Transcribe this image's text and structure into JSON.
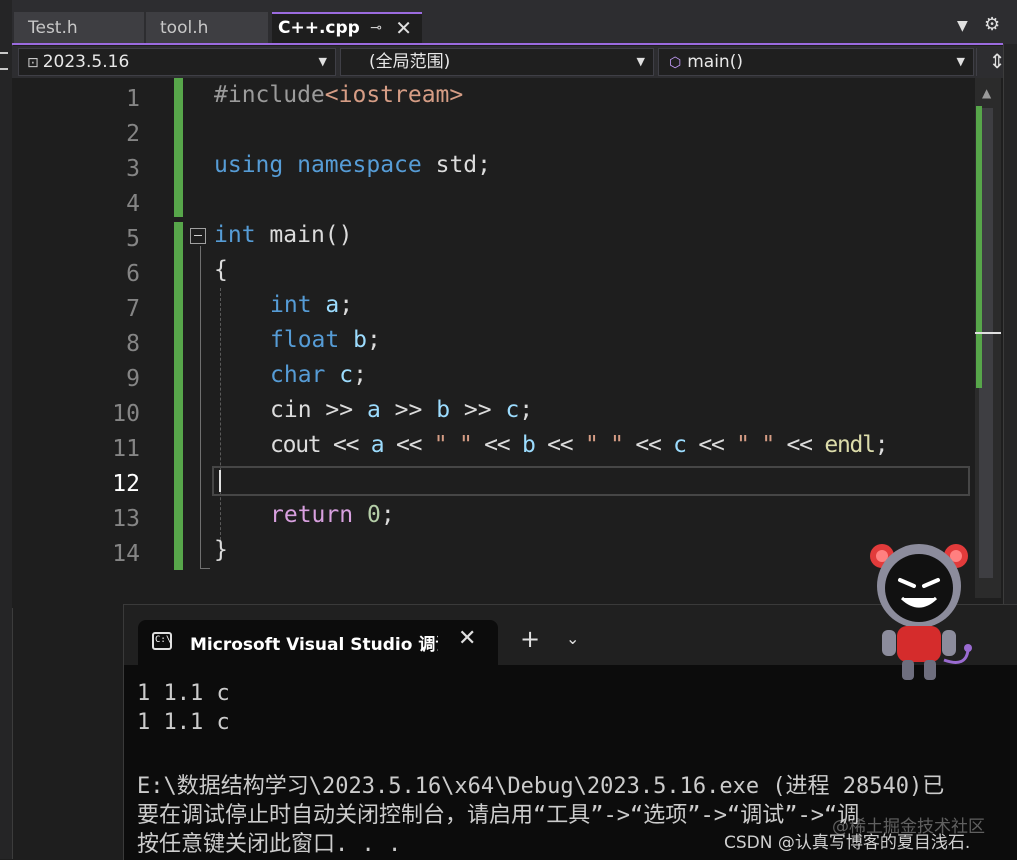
{
  "tabs": [
    {
      "label": "Test.h",
      "active": false
    },
    {
      "label": "tool.h",
      "active": false
    },
    {
      "label": "C++.cpp",
      "active": true
    }
  ],
  "tab_icons": {
    "pin": "pin-icon",
    "close": "close-icon",
    "overflow": "chevron-down-icon",
    "settings": "gear-icon"
  },
  "navbar": {
    "project": "2023.5.16",
    "scope": "(全局范围)",
    "member": "main()"
  },
  "line_numbers": [
    "1",
    "2",
    "3",
    "4",
    "5",
    "6",
    "7",
    "8",
    "9",
    "10",
    "11",
    "12",
    "13",
    "14"
  ],
  "current_line": "12",
  "code": {
    "l1_directive": "#include",
    "l1_header": "<iostream>",
    "l3_using": "using",
    "l3_namespace": "namespace",
    "l3_std": "std;",
    "l5_int": "int",
    "l5_main": "main",
    "l5_parens": "()",
    "l6_brace": "{",
    "l7_type": "int",
    "l7_var": "a",
    "l7_semi": ";",
    "l8_type": "float",
    "l8_var": "b",
    "l8_semi": ";",
    "l9_type": "char",
    "l9_var": "c",
    "l9_semi": ";",
    "l10_cin": "cin",
    "l10_op1": " >> ",
    "l10_a": "a",
    "l10_op2": " >> ",
    "l10_b": "b",
    "l10_op3": " >> ",
    "l10_c": "c",
    "l10_semi": ";",
    "l11_cout": "cout",
    "l11_op1": " << ",
    "l11_a": "a",
    "l11_op2": " << ",
    "l11_s1": "\" \"",
    "l11_op3": " << ",
    "l11_b": "b",
    "l11_op4": " << ",
    "l11_s2": "\" \"",
    "l11_op5": " << ",
    "l11_c": "c",
    "l11_op6": " << ",
    "l11_s3": "\" \"",
    "l11_op7": " << ",
    "l11_endl": "endl",
    "l11_semi": ";",
    "l13_return": "return",
    "l13_zero": "0",
    "l13_semi": ";",
    "l14_brace": "}"
  },
  "console": {
    "tab_title": "Microsoft Visual Studio 调试控制台",
    "lines": [
      "1 1.1 c",
      "1 1.1 c",
      "",
      "E:\\数据结构学习\\2023.5.16\\x64\\Debug\\2023.5.16.exe (进程 28540)已",
      "要在调试停止时自动关闭控制台，请启用“工具”->“选项”->“调试”->“调",
      "按任意键关闭此窗口. . ."
    ]
  },
  "watermarks": {
    "juejin": "@稀土掘金技术社区",
    "csdn": "CSDN @认真写博客的夏目浅石."
  },
  "colors": {
    "accent": "#9b6bdf",
    "keyword": "#569cd6",
    "control": "#d8a0df",
    "variable": "#9cdcfe",
    "change_bar": "#57a64a"
  }
}
